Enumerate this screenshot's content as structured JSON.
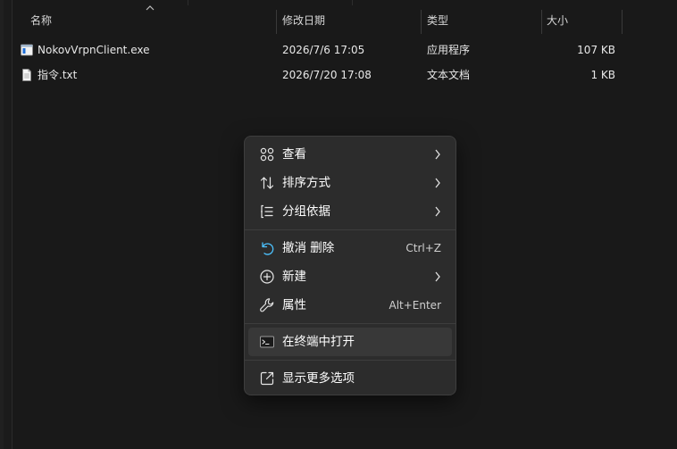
{
  "header": {
    "columns": [
      {
        "id": "name",
        "label": "名称"
      },
      {
        "id": "modified",
        "label": "修改日期"
      },
      {
        "id": "type",
        "label": "类型"
      },
      {
        "id": "size",
        "label": "大小"
      }
    ]
  },
  "files": [
    {
      "name": "NokovVrpnClient.exe",
      "modified": "2026/7/6 17:05",
      "type": "应用程序",
      "size": "107 KB",
      "icon": "exe-file-icon"
    },
    {
      "name": "指令.txt",
      "modified": "2026/7/20 17:08",
      "type": "文本文档",
      "size": "1 KB",
      "icon": "text-file-icon"
    }
  ],
  "context_menu": {
    "groups": [
      [
        {
          "label": "查看",
          "icon": "grid-view-icon",
          "submenu": true
        },
        {
          "label": "排序方式",
          "icon": "sort-arrows-icon",
          "submenu": true
        },
        {
          "label": "分组依据",
          "icon": "group-list-icon",
          "submenu": true
        }
      ],
      [
        {
          "label": "撤消 删除",
          "icon": "undo-icon",
          "shortcut": "Ctrl+Z"
        },
        {
          "label": "新建",
          "icon": "new-plus-icon",
          "submenu": true
        },
        {
          "label": "属性",
          "icon": "wrench-icon",
          "shortcut": "Alt+Enter"
        }
      ],
      [
        {
          "label": "在终端中打开",
          "icon": "terminal-icon",
          "highlighted": true
        }
      ],
      [
        {
          "label": "显示更多选项",
          "icon": "share-more-icon"
        }
      ]
    ]
  },
  "colors": {
    "background": "#191919",
    "menu_background": "#2c2c2c",
    "menu_highlight": "#383838",
    "exe_icon_accent": "#1e6fd9"
  }
}
